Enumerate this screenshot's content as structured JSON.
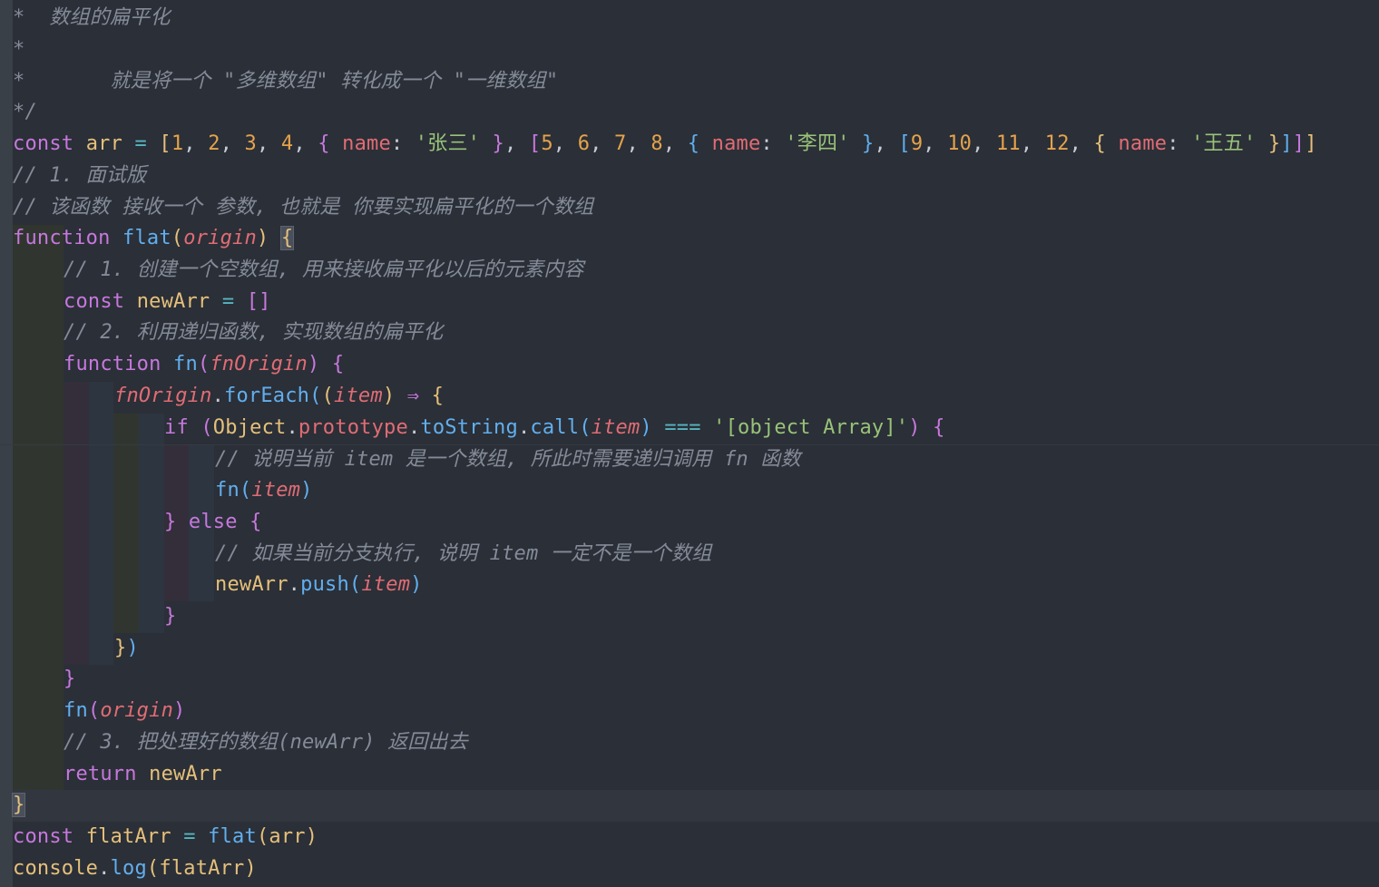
{
  "colors": {
    "background": "#2b2f37",
    "comment": "#848b98",
    "keyword": "#c678dd",
    "variable": "#e5c07b",
    "number": "#e5a34b",
    "string": "#98c379",
    "function": "#61afef",
    "parameter": "#e06c75"
  },
  "code": {
    "l01": {
      "t1": "*  数组的扁平化"
    },
    "l02": {
      "t1": "*"
    },
    "l03": {
      "t1": "*       就是将一个 \"多维数组\" 转化成一个 \"一维数组\""
    },
    "l04": {
      "t1": "*/"
    },
    "l05": {
      "t1": "const",
      "t2": "arr",
      "t3": "=",
      "t4": "[",
      "t5": "1",
      "t6": ", ",
      "t7": "2",
      "t8": ", ",
      "t9": "3",
      "t10": ", ",
      "t11": "4",
      "t12": ", ",
      "t13": "{",
      "t14": "name",
      "t15": ": ",
      "t16": "'张三'",
      "t17": "}",
      "t18": ", ",
      "t19": "[",
      "t20": "5",
      "t21": ", ",
      "t22": "6",
      "t23": ", ",
      "t24": "7",
      "t25": ", ",
      "t26": "8",
      "t27": ", ",
      "t28": "{",
      "t29": "name",
      "t30": ": ",
      "t31": "'李四'",
      "t32": "}",
      "t33": ", ",
      "t34": "[",
      "t35": "9",
      "t36": ", ",
      "t37": "10",
      "t38": ", ",
      "t39": "11",
      "t40": ", ",
      "t41": "12",
      "t42": ", ",
      "t43": "{",
      "t44": "name",
      "t45": ": ",
      "t46": "'王五'",
      "t47": "}",
      "t48": "]",
      "t49": "]",
      "t50": "]"
    },
    "l06": {
      "t1": "// 1. 面试版"
    },
    "l07": {
      "t1": "// 该函数 接收一个 参数, 也就是 你要实现扁平化的一个数组"
    },
    "l08": {
      "t1": "function",
      "t2": "flat",
      "t3": "(",
      "t4": "origin",
      "t5": ")",
      "t6": "{"
    },
    "l09": {
      "t1": "// 1. 创建一个空数组, 用来接收扁平化以后的元素内容"
    },
    "l10": {
      "t1": "const",
      "t2": "newArr",
      "t3": "=",
      "t4": "[]"
    },
    "l11": {
      "t1": "// 2. 利用递归函数, 实现数组的扁平化"
    },
    "l12": {
      "t1": "function",
      "t2": "fn",
      "t3": "(",
      "t4": "fnOrigin",
      "t5": ")",
      "t6": "{"
    },
    "l13": {
      "t1": "fnOrigin",
      "t2": ".",
      "t3": "forEach",
      "t4": "(",
      "t5": "(",
      "t6": "item",
      "t7": ")",
      "t8": "⇒",
      "t9": "{"
    },
    "l14": {
      "t1": "if",
      "t2": "(",
      "t3": "Object",
      "t4": ".",
      "t5": "prototype",
      "t6": ".",
      "t7": "toString",
      "t8": ".",
      "t9": "call",
      "t10": "(",
      "t11": "item",
      "t12": ")",
      "t13": "===",
      "t14": "'[object Array]'",
      "t15": ")",
      "t16": "{"
    },
    "l15": {
      "t1": "// 说明当前 item 是一个数组, 所此时需要递归调用 fn 函数"
    },
    "l16": {
      "t1": "fn",
      "t2": "(",
      "t3": "item",
      "t4": ")"
    },
    "l17": {
      "t1": "}",
      "t2": "else",
      "t3": "{"
    },
    "l18": {
      "t1": "// 如果当前分支执行, 说明 item 一定不是一个数组"
    },
    "l19": {
      "t1": "newArr",
      "t2": ".",
      "t3": "push",
      "t4": "(",
      "t5": "item",
      "t6": ")"
    },
    "l20": {
      "t1": "}"
    },
    "l21": {
      "t1": "}",
      "t2": ")"
    },
    "l22": {
      "t1": "}"
    },
    "l23": {
      "t1": "fn",
      "t2": "(",
      "t3": "origin",
      "t4": ")"
    },
    "l24": {
      "t1": "// 3. 把处理好的数组(newArr) 返回出去"
    },
    "l25": {
      "t1": "return",
      "t2": "newArr"
    },
    "l26": {
      "t1": "}"
    },
    "l27": {
      "t1": "const",
      "t2": "flatArr",
      "t3": "=",
      "t4": "flat",
      "t5": "(",
      "t6": "arr",
      "t7": ")"
    },
    "l28": {
      "t1": "console",
      "t2": ".",
      "t3": "log",
      "t4": "(",
      "t5": "flatArr",
      "t6": ")"
    }
  }
}
